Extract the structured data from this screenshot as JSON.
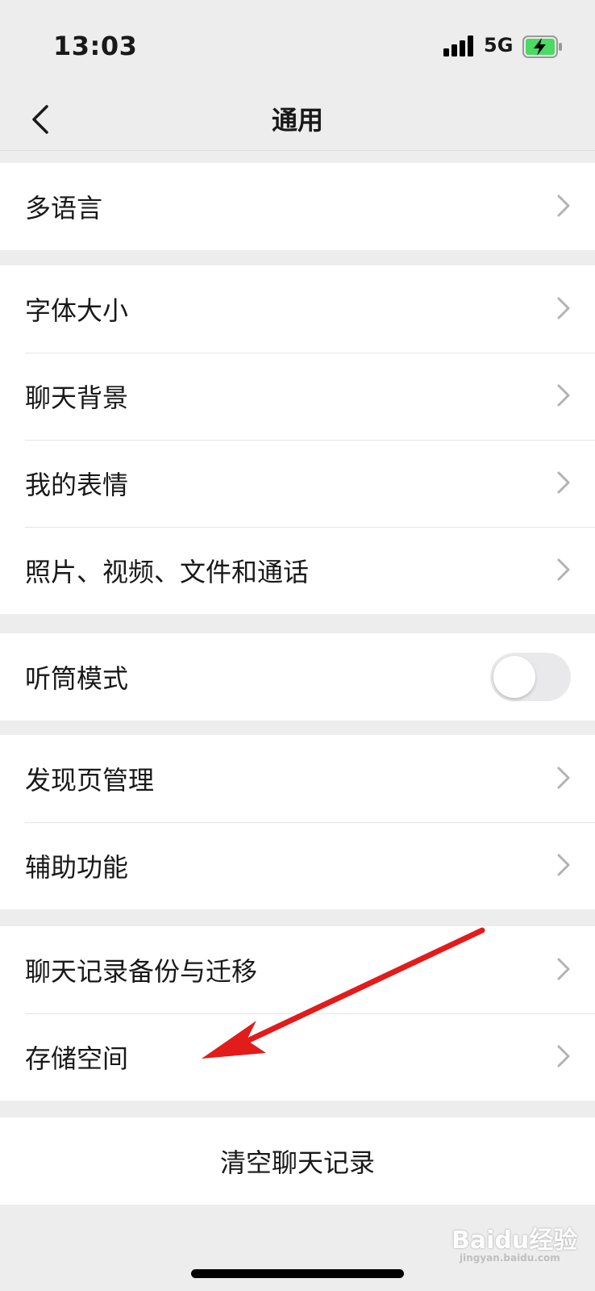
{
  "status_bar": {
    "time": "13:03",
    "network": "5G",
    "battery_color": "#4cd964"
  },
  "nav": {
    "title": "通用"
  },
  "groups": [
    {
      "items": [
        {
          "label": "多语言"
        }
      ]
    },
    {
      "items": [
        {
          "label": "字体大小"
        },
        {
          "label": "聊天背景"
        },
        {
          "label": "我的表情"
        },
        {
          "label": "照片、视频、文件和通话"
        }
      ]
    },
    {
      "items": [
        {
          "label": "听筒模式",
          "toggle": false
        }
      ]
    },
    {
      "items": [
        {
          "label": "发现页管理"
        },
        {
          "label": "辅助功能"
        }
      ]
    },
    {
      "items": [
        {
          "label": "聊天记录备份与迁移"
        },
        {
          "label": "存储空间"
        }
      ]
    }
  ],
  "clear_button": {
    "label": "清空聊天记录"
  },
  "annotation": {
    "arrow_color": "#e21b1b"
  },
  "watermark": {
    "text": "Baidu经验",
    "sub": "jingyan.baidu.com"
  }
}
